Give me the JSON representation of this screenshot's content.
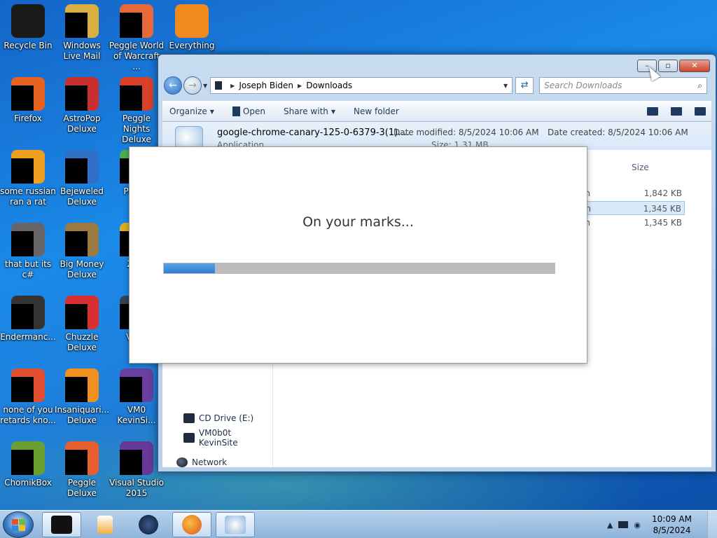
{
  "desktop": {
    "icons": [
      {
        "label": "Recycle Bin",
        "icon": "recycle-bin-icon",
        "color": "#1a1a1a"
      },
      {
        "label": "Windows Live Mail",
        "icon": "windows-live-mail-icon",
        "color": "#d9b040"
      },
      {
        "label": "Peggle World of Warcraft ...",
        "icon": "peggle-wow-icon",
        "color": "#e8683a"
      },
      {
        "label": "Everything",
        "icon": "everything-icon",
        "color": "#f08a1e"
      },
      {
        "label": "Firefox",
        "icon": "firefox-icon",
        "color": "#e8621f"
      },
      {
        "label": "AstroPop Deluxe",
        "icon": "astropop-icon",
        "color": "#c83030"
      },
      {
        "label": "Peggle Nights Deluxe",
        "icon": "peggle-nights-icon",
        "color": "#d8402a"
      },
      {
        "label": "some russian ran a rat",
        "icon": "russian-rat-icon",
        "color": "#f0a020"
      },
      {
        "label": "Bejeweled Deluxe",
        "icon": "bejeweled-icon",
        "color": "#3070c8"
      },
      {
        "label": "Pla Zo",
        "icon": "plants-zombies-icon",
        "color": "#4caf50"
      },
      {
        "label": "that but its c#",
        "icon": "windows-stack-icon",
        "color": "#666666"
      },
      {
        "label": "Big Money Deluxe",
        "icon": "big-money-icon",
        "color": "#9a7a40"
      },
      {
        "label": "Zum",
        "icon": "zuma-icon",
        "color": "#d8b020"
      },
      {
        "label": "Endermanc...",
        "icon": "endermanch-icon",
        "color": "#333333"
      },
      {
        "label": "Chuzzle Deluxe",
        "icon": "chuzzle-icon",
        "color": "#d83030"
      },
      {
        "label": "Vi Ke",
        "icon": "vm-icon",
        "color": "#334455"
      },
      {
        "label": "none of you retards kno...",
        "icon": "chrome-like-icon",
        "color": "#e05030"
      },
      {
        "label": "Insaniquari... Deluxe",
        "icon": "insaniquarium-icon",
        "color": "#f09020"
      },
      {
        "label": "VM0 KevinSi...",
        "icon": "vm0-kevinsite-icon",
        "color": "#6a3fa0"
      },
      {
        "label": "ChomikBox",
        "icon": "chomikbox-icon",
        "color": "#6aa030"
      },
      {
        "label": "Peggle Deluxe",
        "icon": "peggle-deluxe-icon",
        "color": "#e86030"
      },
      {
        "label": "Visual Studio 2015",
        "icon": "visual-studio-icon",
        "color": "#68379a"
      }
    ]
  },
  "explorer": {
    "breadcrumb": [
      "Joseph Biden",
      "Downloads"
    ],
    "search_placeholder": "Search Downloads",
    "toolbar": {
      "organize": "Organize",
      "open": "Open",
      "share_with": "Share with",
      "new_folder": "New folder"
    },
    "file_details": {
      "name": "google-chrome-canary-125-0-6379-3(1)....",
      "type": "Application",
      "date_modified": "Date modified: 8/5/2024 10:06 AM",
      "size": "Size: 1.31 MB",
      "date_created": "Date created: 8/5/2024 10:06 AM"
    },
    "columns": {
      "size": "Size"
    },
    "rows": [
      {
        "type_tail": "on",
        "size": "1,842 KB",
        "selected": false
      },
      {
        "type_tail": "on",
        "size": "1,345 KB",
        "selected": true
      },
      {
        "type_tail": "on",
        "size": "1,345 KB",
        "selected": false
      }
    ],
    "nav": {
      "cd_drive": "CD Drive (E:)",
      "vm_site": "VM0b0t KevinSite",
      "network": "Network"
    }
  },
  "dialog": {
    "message": "On your marks...",
    "progress": 0.13
  },
  "taskbar": {
    "time": "10:09 AM",
    "date": "8/5/2024",
    "accent": "#2f7fd6"
  }
}
